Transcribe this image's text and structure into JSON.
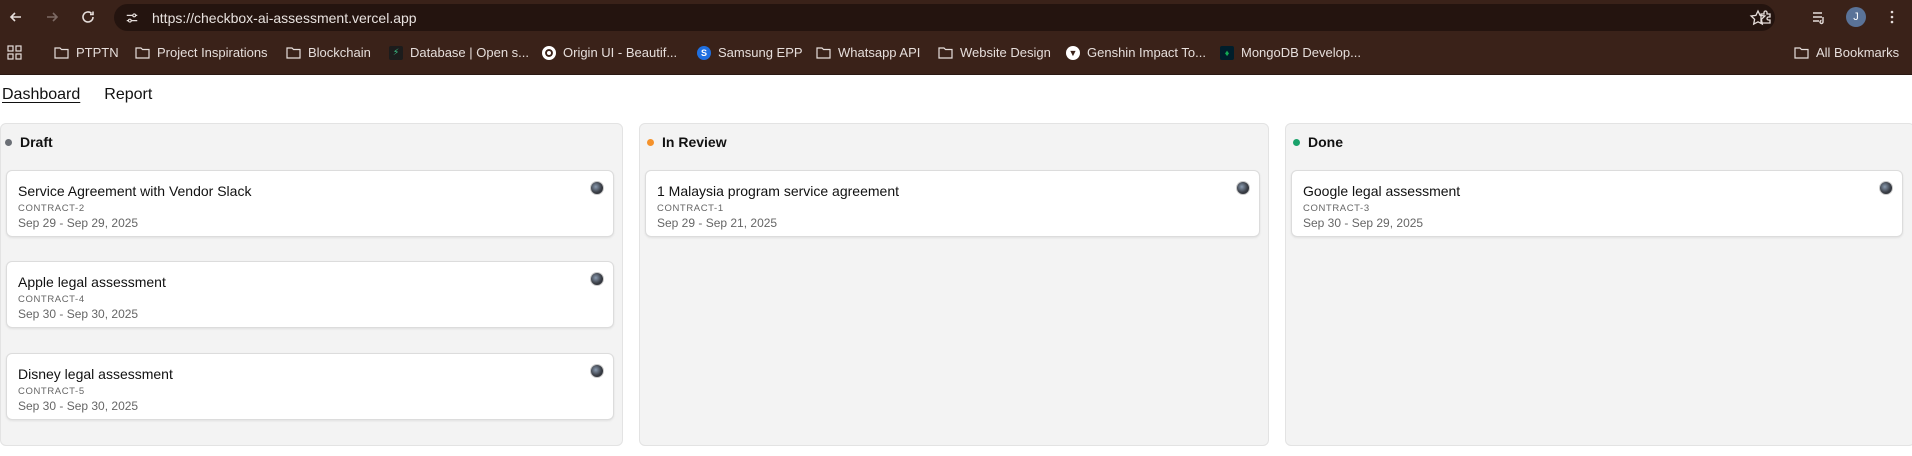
{
  "browser": {
    "url": "https://checkbox-ai-assessment.vercel.app",
    "profile_initial": "J",
    "bookmarks": [
      {
        "label": "PTPTN",
        "icon": "folder-icon"
      },
      {
        "label": "Project Inspirations",
        "icon": "folder-icon"
      },
      {
        "label": "Blockchain",
        "icon": "folder-icon"
      },
      {
        "label": "Database | Open s...",
        "icon": "supabase-icon"
      },
      {
        "label": "Origin UI - Beautif...",
        "icon": "origin-icon"
      },
      {
        "label": "Samsung EPP",
        "icon": "samsung-icon"
      },
      {
        "label": "Whatsapp API",
        "icon": "folder-icon"
      },
      {
        "label": "Website Design",
        "icon": "folder-icon"
      },
      {
        "label": "Genshin Impact To...",
        "icon": "genshin-icon"
      },
      {
        "label": "MongoDB Develop...",
        "icon": "mongodb-icon"
      }
    ],
    "all_bookmarks": "All Bookmarks"
  },
  "nav": {
    "dashboard": "Dashboard",
    "report": "Report"
  },
  "colors": {
    "draft": "#6b6f76",
    "in_review": "#f5922b",
    "done": "#1aa26b"
  },
  "columns": [
    {
      "title": "Draft",
      "cards": [
        {
          "title": "Service Agreement with Vendor Slack",
          "id": "CONTRACT-2",
          "dates": "Sep 29 - Sep 29, 2025"
        },
        {
          "title": "Apple legal assessment",
          "id": "CONTRACT-4",
          "dates": "Sep 30 - Sep 30, 2025"
        },
        {
          "title": "Disney legal assessment",
          "id": "CONTRACT-5",
          "dates": "Sep 30 - Sep 30, 2025"
        }
      ]
    },
    {
      "title": "In Review",
      "cards": [
        {
          "title": "1 Malaysia program service agreement",
          "id": "CONTRACT-1",
          "dates": "Sep 29 - Sep 21, 2025"
        }
      ]
    },
    {
      "title": "Done",
      "cards": [
        {
          "title": "Google legal assessment",
          "id": "CONTRACT-3",
          "dates": "Sep 30 - Sep 29, 2025"
        }
      ]
    }
  ]
}
